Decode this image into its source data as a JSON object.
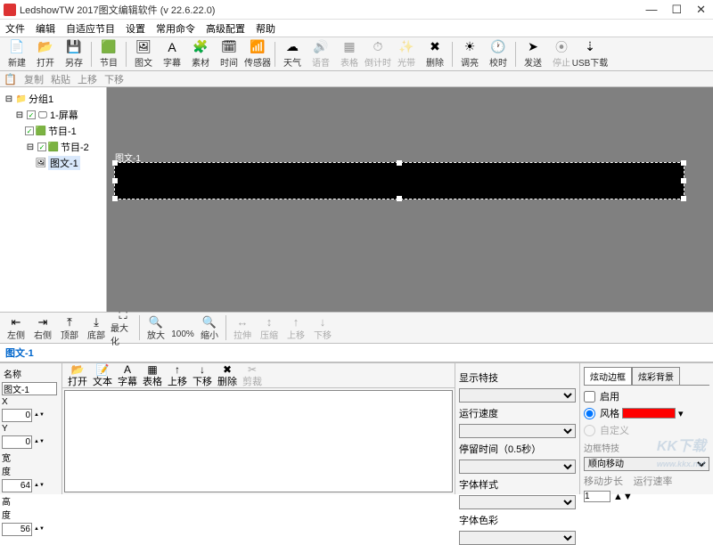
{
  "window": {
    "title": "LedshowTW 2017图文编辑软件 (v 22.6.22.0)"
  },
  "menu": [
    "文件",
    "编辑",
    "自适应节目",
    "设置",
    "常用命令",
    "高级配置",
    "帮助"
  ],
  "toolbar": [
    {
      "label": "新建",
      "icon": "📄"
    },
    {
      "label": "打开",
      "icon": "📂"
    },
    {
      "label": "另存",
      "icon": "💾"
    },
    {
      "sep": true
    },
    {
      "label": "节目",
      "icon": "🟩"
    },
    {
      "sep": true
    },
    {
      "label": "图文",
      "icon": "🖼"
    },
    {
      "label": "字幕",
      "icon": "A"
    },
    {
      "label": "素材",
      "icon": "🧩"
    },
    {
      "label": "时间",
      "icon": "🗓"
    },
    {
      "label": "传感器",
      "icon": "📶"
    },
    {
      "sep": true
    },
    {
      "label": "天气",
      "icon": "☁"
    },
    {
      "label": "语音",
      "icon": "🔊",
      "dis": true
    },
    {
      "label": "表格",
      "icon": "▦",
      "dis": true
    },
    {
      "label": "倒计时",
      "icon": "⏱",
      "dis": true
    },
    {
      "label": "光带",
      "icon": "✨",
      "dis": true
    },
    {
      "label": "删除",
      "icon": "✖"
    },
    {
      "sep": true
    },
    {
      "label": "调亮",
      "icon": "☀"
    },
    {
      "label": "校时",
      "icon": "🕐"
    },
    {
      "sep": true
    },
    {
      "label": "发送",
      "icon": "➤"
    },
    {
      "label": "停止",
      "icon": "⦿",
      "dis": true
    },
    {
      "label": "USB下载",
      "icon": "⇣"
    }
  ],
  "secondbar": [
    "复制",
    "粘贴",
    "上移",
    "下移"
  ],
  "tree": [
    {
      "label": "分组1",
      "ind": 0,
      "icon": "📁",
      "expander": "−"
    },
    {
      "label": "1-屏幕",
      "ind": 1,
      "icon": "🖵",
      "check": true,
      "expander": "−"
    },
    {
      "label": "节目-1",
      "ind": 2,
      "icon": "🟩",
      "check": true,
      "expander": ""
    },
    {
      "label": "节目-2",
      "ind": 2,
      "icon": "🟩",
      "check": true,
      "expander": "−"
    },
    {
      "label": "图文-1",
      "ind": 3,
      "icon": "🖼",
      "sel": true
    }
  ],
  "tabname": "图文-1",
  "midbar": [
    {
      "label": "左侧",
      "icon": "⇤"
    },
    {
      "label": "右侧",
      "icon": "⇥"
    },
    {
      "label": "顶部",
      "icon": "⤒"
    },
    {
      "label": "底部",
      "icon": "⤓"
    },
    {
      "label": "最大化",
      "icon": "⛶"
    },
    {
      "sep": true
    },
    {
      "label": "放大",
      "icon": "🔍"
    },
    {
      "label": "100%",
      "icon": ""
    },
    {
      "label": "缩小",
      "icon": "🔍"
    },
    {
      "sep": true
    },
    {
      "label": "拉伸",
      "icon": "↔",
      "dis": true
    },
    {
      "label": "压缩",
      "icon": "↕",
      "dis": true
    },
    {
      "label": "上移",
      "icon": "↑",
      "dis": true
    },
    {
      "label": "下移",
      "icon": "↓",
      "dis": true
    }
  ],
  "props": {
    "name_hdr": "名称",
    "name": "图文-1",
    "x_lbl": "X",
    "x": "0",
    "y_lbl": "Y",
    "y": "0",
    "w_lbl": "宽度",
    "w": "64",
    "h_lbl": "高度",
    "h": "56"
  },
  "filebar": [
    {
      "label": "打开",
      "icon": "📂"
    },
    {
      "label": "文本",
      "icon": "📝"
    },
    {
      "label": "字幕",
      "icon": "A"
    },
    {
      "label": "表格",
      "icon": "▦"
    },
    {
      "label": "上移",
      "icon": "↑"
    },
    {
      "label": "下移",
      "icon": "↓"
    },
    {
      "label": "删除",
      "icon": "✖"
    },
    {
      "label": "剪裁",
      "icon": "✂",
      "dis": true
    }
  ],
  "rightprops": {
    "display_fx": "显示特技",
    "speed": "运行速度",
    "stay": "停留时间（0.5秒）",
    "font_style": "字体样式",
    "font_color": "字体色彩"
  },
  "farright": {
    "tab1": "炫动边框",
    "tab2": "炫彩背景",
    "enable": "启用",
    "style": "风格",
    "custom": "自定义",
    "border_fx": "边框特技",
    "border_fx_val": "顺向移动",
    "move_step": "移动步长",
    "move_step_val": "1",
    "run_rate": "运行速率"
  }
}
